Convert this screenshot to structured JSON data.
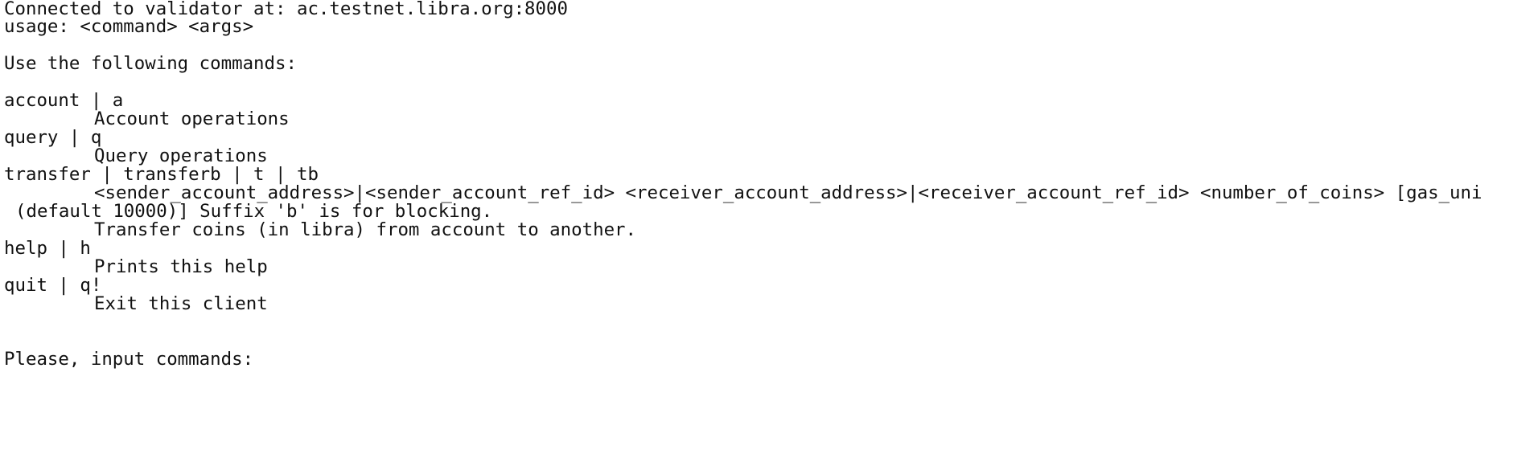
{
  "terminal": {
    "connected_line": "Connected to validator at: ac.testnet.libra.org:8000",
    "usage_line": "usage: <command> <args>",
    "intro_line": "Use the following commands:",
    "commands": [
      {
        "name": "account | a",
        "desc": "Account operations"
      },
      {
        "name": "query | q",
        "desc": "Query operations"
      },
      {
        "name": "transfer | transferb | t | tb",
        "args": "<sender_account_address>|<sender_account_ref_id> <receiver_account_address>|<receiver_account_ref_id> <number_of_coins> [gas_uni",
        "args_cont": "(default 10000)] Suffix 'b' is for blocking.",
        "desc": "Transfer coins (in libra) from account to another."
      },
      {
        "name": "help | h",
        "desc": "Prints this help"
      },
      {
        "name": "quit | q!",
        "desc": "Exit this client"
      }
    ],
    "prompt": "Please, input commands:"
  }
}
